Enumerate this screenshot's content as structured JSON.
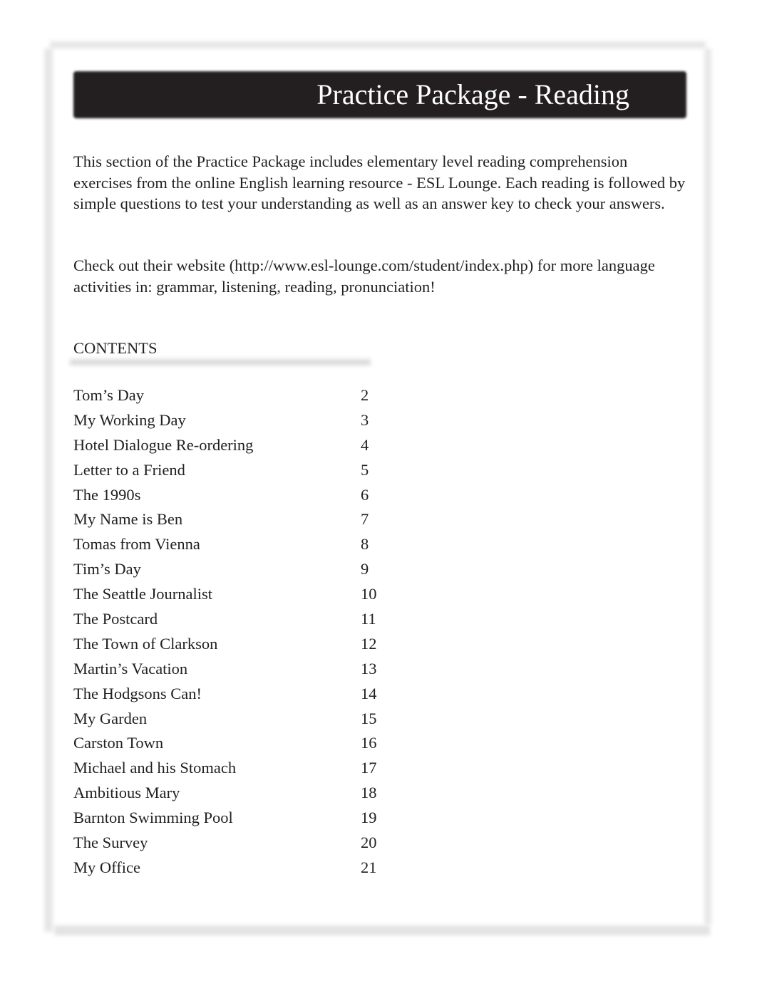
{
  "header": {
    "title": "Practice Package - Reading"
  },
  "intro": {
    "paragraph1": "This section of the Practice Package includes elementary level reading comprehension exercises from the online English learning resource - ESL Lounge. Each reading is followed by simple questions to test your understanding as well as an answer key to check your answers.",
    "paragraph2": "Check out their website (http://www.esl-lounge.com/student/index.php) for more language activities in: grammar, listening, reading, pronunciation!"
  },
  "contents": {
    "heading": "CONTENTS",
    "items": [
      {
        "title": "Tom’s Day",
        "page": "2"
      },
      {
        "title": "My Working Day",
        "page": "3"
      },
      {
        "title": "Hotel Dialogue Re-ordering",
        "page": "4"
      },
      {
        "title": "Letter to a Friend",
        "page": "5"
      },
      {
        "title": "The 1990s",
        "page": "6"
      },
      {
        "title": "My Name is Ben",
        "page": "7"
      },
      {
        "title": "Tomas from Vienna",
        "page": "8"
      },
      {
        "title": "Tim’s Day",
        "page": "9"
      },
      {
        "title": "The Seattle Journalist",
        "page": "10"
      },
      {
        "title": "The Postcard",
        "page": "11"
      },
      {
        "title": "The Town of Clarkson",
        "page": "12"
      },
      {
        "title": "Martin’s Vacation",
        "page": "13"
      },
      {
        "title": "The Hodgsons Can!",
        "page": "14"
      },
      {
        "title": "My Garden",
        "page": "15"
      },
      {
        "title": "Carston Town",
        "page": "16"
      },
      {
        "title": "Michael and his Stomach",
        "page": "17"
      },
      {
        "title": "Ambitious Mary",
        "page": "18"
      },
      {
        "title": "Barnton Swimming Pool",
        "page": "19"
      },
      {
        "title": "The Survey",
        "page": "20"
      },
      {
        "title": "My Office",
        "page": "21"
      }
    ]
  }
}
